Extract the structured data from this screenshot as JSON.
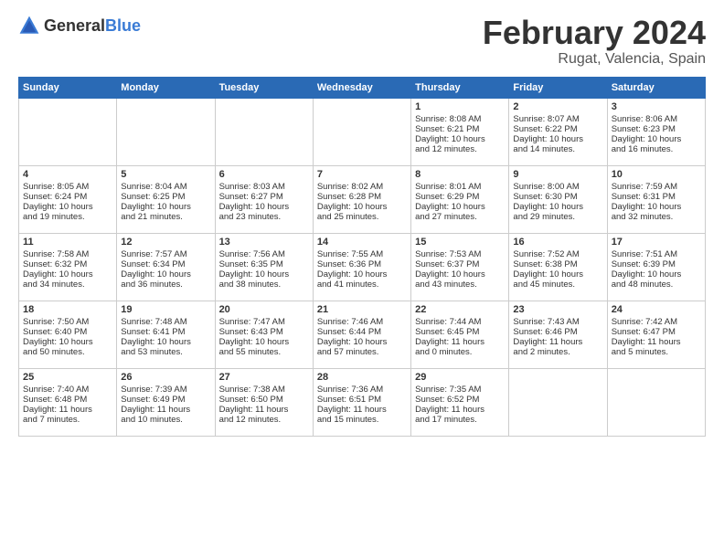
{
  "header": {
    "logo_general": "General",
    "logo_blue": "Blue",
    "title": "February 2024",
    "subtitle": "Rugat, Valencia, Spain"
  },
  "weekdays": [
    "Sunday",
    "Monday",
    "Tuesday",
    "Wednesday",
    "Thursday",
    "Friday",
    "Saturday"
  ],
  "weeks": [
    [
      {
        "day": "",
        "content": ""
      },
      {
        "day": "",
        "content": ""
      },
      {
        "day": "",
        "content": ""
      },
      {
        "day": "",
        "content": ""
      },
      {
        "day": "1",
        "content": "Sunrise: 8:08 AM\nSunset: 6:21 PM\nDaylight: 10 hours\nand 12 minutes."
      },
      {
        "day": "2",
        "content": "Sunrise: 8:07 AM\nSunset: 6:22 PM\nDaylight: 10 hours\nand 14 minutes."
      },
      {
        "day": "3",
        "content": "Sunrise: 8:06 AM\nSunset: 6:23 PM\nDaylight: 10 hours\nand 16 minutes."
      }
    ],
    [
      {
        "day": "4",
        "content": "Sunrise: 8:05 AM\nSunset: 6:24 PM\nDaylight: 10 hours\nand 19 minutes."
      },
      {
        "day": "5",
        "content": "Sunrise: 8:04 AM\nSunset: 6:25 PM\nDaylight: 10 hours\nand 21 minutes."
      },
      {
        "day": "6",
        "content": "Sunrise: 8:03 AM\nSunset: 6:27 PM\nDaylight: 10 hours\nand 23 minutes."
      },
      {
        "day": "7",
        "content": "Sunrise: 8:02 AM\nSunset: 6:28 PM\nDaylight: 10 hours\nand 25 minutes."
      },
      {
        "day": "8",
        "content": "Sunrise: 8:01 AM\nSunset: 6:29 PM\nDaylight: 10 hours\nand 27 minutes."
      },
      {
        "day": "9",
        "content": "Sunrise: 8:00 AM\nSunset: 6:30 PM\nDaylight: 10 hours\nand 29 minutes."
      },
      {
        "day": "10",
        "content": "Sunrise: 7:59 AM\nSunset: 6:31 PM\nDaylight: 10 hours\nand 32 minutes."
      }
    ],
    [
      {
        "day": "11",
        "content": "Sunrise: 7:58 AM\nSunset: 6:32 PM\nDaylight: 10 hours\nand 34 minutes."
      },
      {
        "day": "12",
        "content": "Sunrise: 7:57 AM\nSunset: 6:34 PM\nDaylight: 10 hours\nand 36 minutes."
      },
      {
        "day": "13",
        "content": "Sunrise: 7:56 AM\nSunset: 6:35 PM\nDaylight: 10 hours\nand 38 minutes."
      },
      {
        "day": "14",
        "content": "Sunrise: 7:55 AM\nSunset: 6:36 PM\nDaylight: 10 hours\nand 41 minutes."
      },
      {
        "day": "15",
        "content": "Sunrise: 7:53 AM\nSunset: 6:37 PM\nDaylight: 10 hours\nand 43 minutes."
      },
      {
        "day": "16",
        "content": "Sunrise: 7:52 AM\nSunset: 6:38 PM\nDaylight: 10 hours\nand 45 minutes."
      },
      {
        "day": "17",
        "content": "Sunrise: 7:51 AM\nSunset: 6:39 PM\nDaylight: 10 hours\nand 48 minutes."
      }
    ],
    [
      {
        "day": "18",
        "content": "Sunrise: 7:50 AM\nSunset: 6:40 PM\nDaylight: 10 hours\nand 50 minutes."
      },
      {
        "day": "19",
        "content": "Sunrise: 7:48 AM\nSunset: 6:41 PM\nDaylight: 10 hours\nand 53 minutes."
      },
      {
        "day": "20",
        "content": "Sunrise: 7:47 AM\nSunset: 6:43 PM\nDaylight: 10 hours\nand 55 minutes."
      },
      {
        "day": "21",
        "content": "Sunrise: 7:46 AM\nSunset: 6:44 PM\nDaylight: 10 hours\nand 57 minutes."
      },
      {
        "day": "22",
        "content": "Sunrise: 7:44 AM\nSunset: 6:45 PM\nDaylight: 11 hours\nand 0 minutes."
      },
      {
        "day": "23",
        "content": "Sunrise: 7:43 AM\nSunset: 6:46 PM\nDaylight: 11 hours\nand 2 minutes."
      },
      {
        "day": "24",
        "content": "Sunrise: 7:42 AM\nSunset: 6:47 PM\nDaylight: 11 hours\nand 5 minutes."
      }
    ],
    [
      {
        "day": "25",
        "content": "Sunrise: 7:40 AM\nSunset: 6:48 PM\nDaylight: 11 hours\nand 7 minutes."
      },
      {
        "day": "26",
        "content": "Sunrise: 7:39 AM\nSunset: 6:49 PM\nDaylight: 11 hours\nand 10 minutes."
      },
      {
        "day": "27",
        "content": "Sunrise: 7:38 AM\nSunset: 6:50 PM\nDaylight: 11 hours\nand 12 minutes."
      },
      {
        "day": "28",
        "content": "Sunrise: 7:36 AM\nSunset: 6:51 PM\nDaylight: 11 hours\nand 15 minutes."
      },
      {
        "day": "29",
        "content": "Sunrise: 7:35 AM\nSunset: 6:52 PM\nDaylight: 11 hours\nand 17 minutes."
      },
      {
        "day": "",
        "content": ""
      },
      {
        "day": "",
        "content": ""
      }
    ]
  ]
}
